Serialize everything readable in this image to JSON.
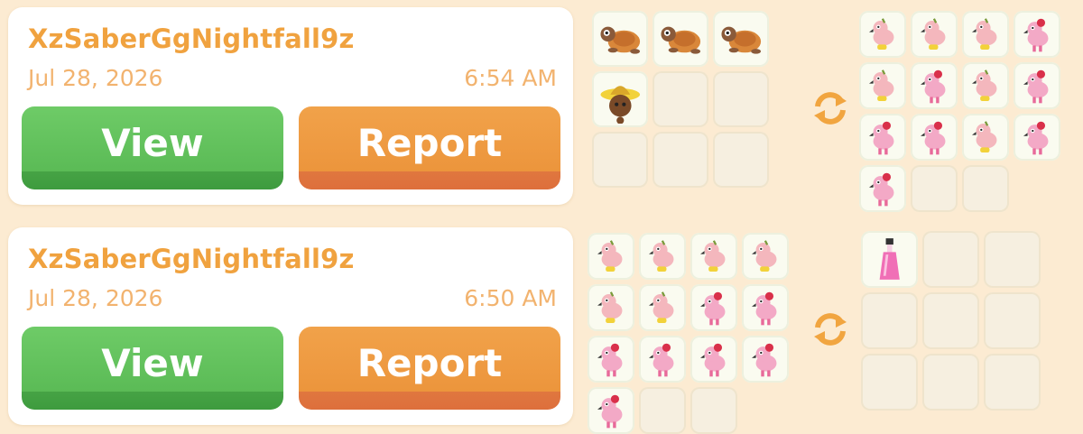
{
  "colors": {
    "background": "#fcebd2",
    "username": "#f0a23f",
    "meta_text": "#f2b36f",
    "view_green": "#5bbb56",
    "report_orange": "#ec953c",
    "swap_icon": "#f1a540"
  },
  "trades": [
    {
      "username": "XzSaberGgNightfall9z",
      "date": "Jul 28, 2026",
      "time": "6:54 AM",
      "view_label": "View",
      "report_label": "Report",
      "offer_items": [
        "turtle-icon",
        "turtle-icon",
        "turtle-icon",
        "scarecrow-icon",
        "",
        "",
        "",
        "",
        ""
      ],
      "swap_icon": "swap-arrows-icon",
      "request_items": [
        "flamingo-icon",
        "flamingo-icon",
        "flamingo-icon",
        "flamingo-pink-icon",
        "flamingo-icon",
        "flamingo-pink-icon",
        "flamingo-icon",
        "flamingo-pink-icon",
        "flamingo-pink-icon",
        "flamingo-pink-icon",
        "flamingo-icon",
        "flamingo-pink-icon",
        "flamingo-pink-icon",
        "",
        ""
      ]
    },
    {
      "username": "XzSaberGgNightfall9z",
      "date": "Jul 28, 2026",
      "time": "6:50 AM",
      "view_label": "View",
      "report_label": "Report",
      "offer_items": [
        "flamingo-icon",
        "flamingo-icon",
        "flamingo-icon",
        "flamingo-icon",
        "flamingo-icon",
        "flamingo-icon",
        "flamingo-pink-icon",
        "flamingo-pink-icon",
        "flamingo-pink-icon",
        "flamingo-pink-icon",
        "flamingo-pink-icon",
        "flamingo-pink-icon",
        "flamingo-pink-icon",
        "",
        ""
      ],
      "swap_icon": "swap-arrows-icon",
      "request_items": [
        "potion-icon",
        "",
        "",
        "",
        "",
        "",
        "",
        "",
        ""
      ]
    }
  ]
}
